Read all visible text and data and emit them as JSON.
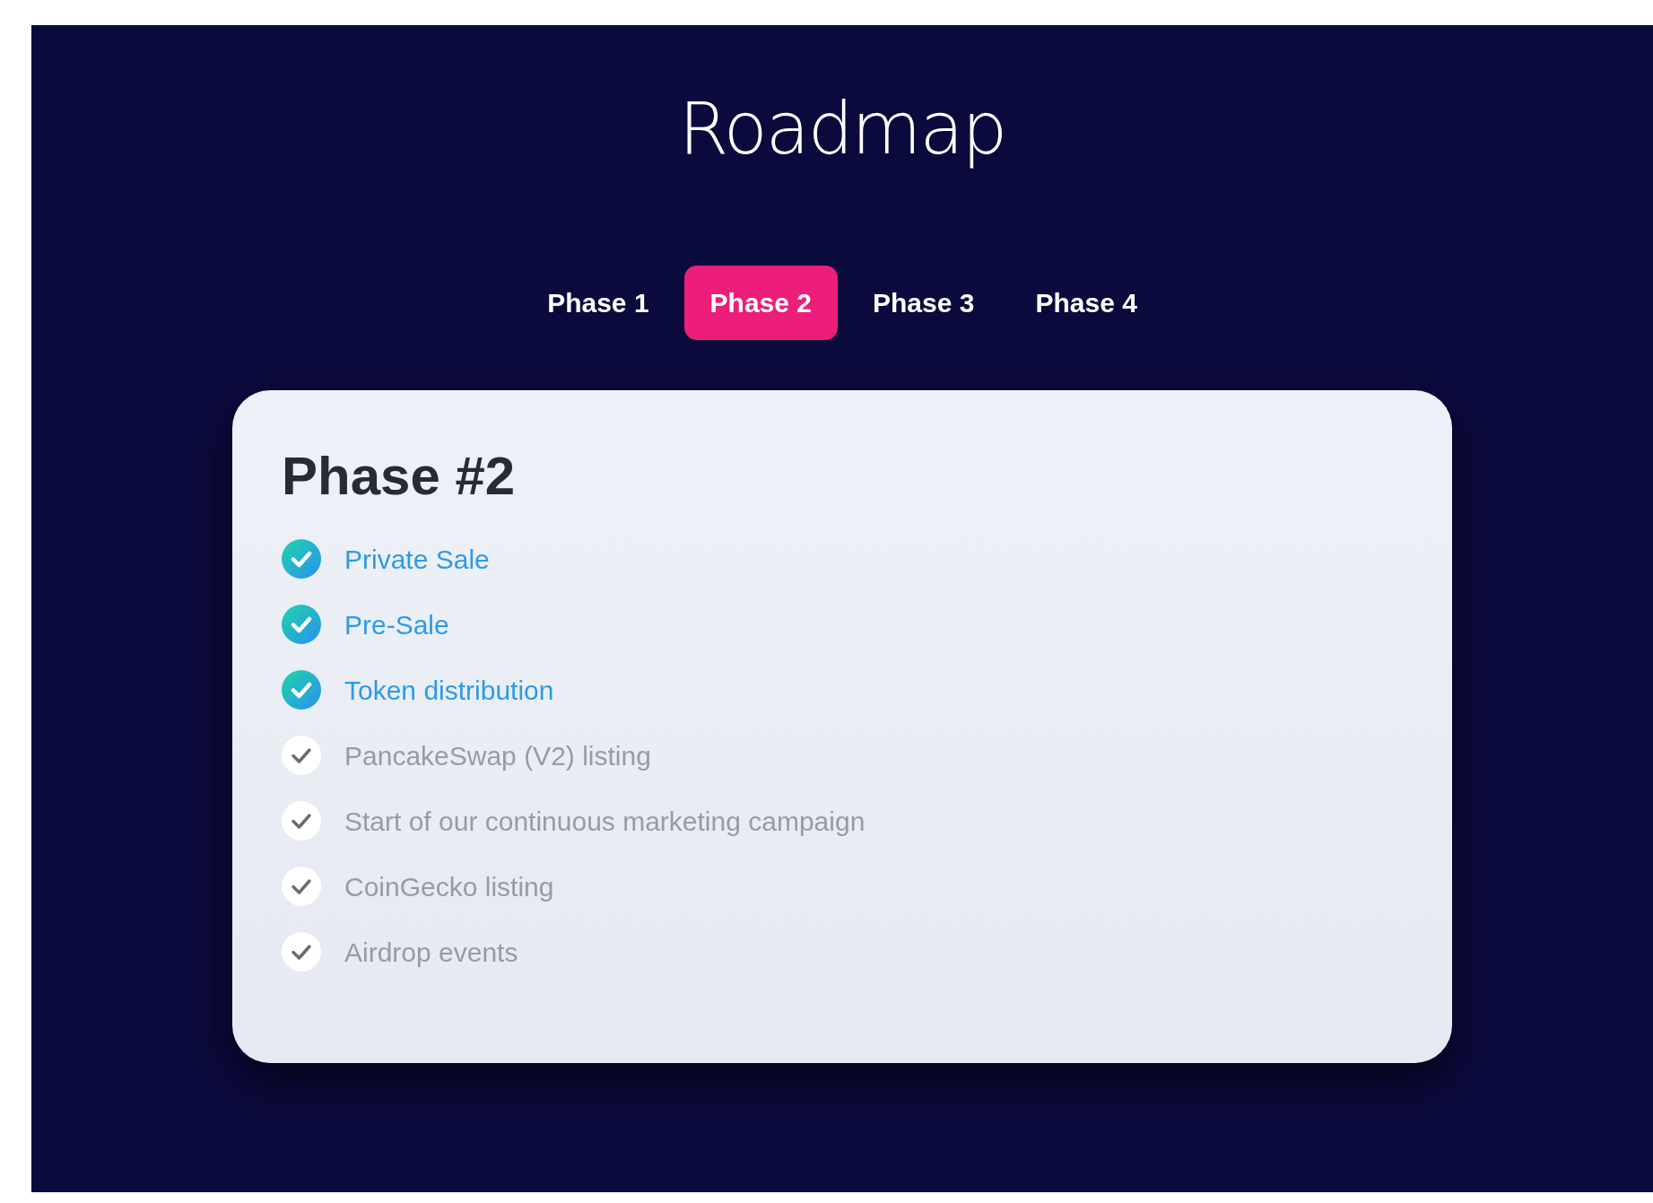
{
  "title": "Roadmap",
  "tabs": [
    {
      "label": "Phase 1",
      "selected": false
    },
    {
      "label": "Phase 2",
      "selected": true
    },
    {
      "label": "Phase 3",
      "selected": false
    },
    {
      "label": "Phase 4",
      "selected": false
    }
  ],
  "card": {
    "heading": "Phase #2",
    "items": [
      {
        "text": "Private Sale",
        "done": true
      },
      {
        "text": "Pre-Sale",
        "done": true
      },
      {
        "text": "Token distribution",
        "done": true
      },
      {
        "text": "PancakeSwap (V2) listing",
        "done": false
      },
      {
        "text": "Start of our continuous marketing campaign",
        "done": false
      },
      {
        "text": "CoinGecko listing",
        "done": false
      },
      {
        "text": "Airdrop events",
        "done": false
      }
    ]
  }
}
